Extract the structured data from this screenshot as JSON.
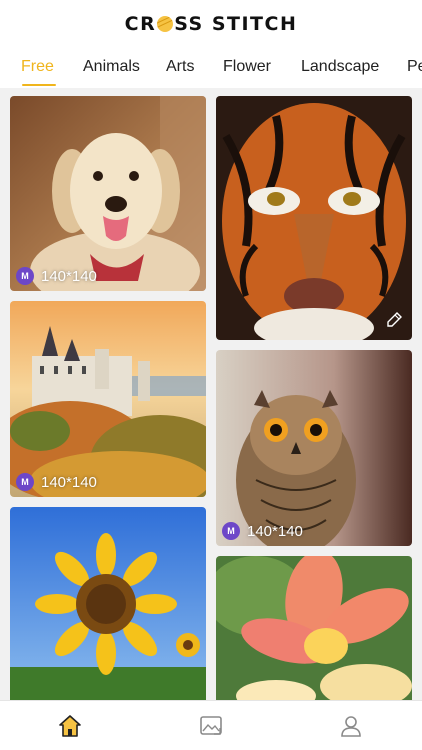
{
  "app": {
    "title_left": "CR",
    "title_right": "SS STITCH"
  },
  "tabs": [
    {
      "label": "Free",
      "active": true
    },
    {
      "label": "Animals",
      "active": false
    },
    {
      "label": "Arts",
      "active": false
    },
    {
      "label": "Flower",
      "active": false
    },
    {
      "label": "Landscape",
      "active": false
    },
    {
      "label": "Pe",
      "active": false
    }
  ],
  "colors": {
    "accent": "#f0b51c",
    "badge": "#6d47c8"
  },
  "cards": [
    {
      "subject": "golden retriever dog",
      "badge": "M",
      "size": "140*140"
    },
    {
      "subject": "tiger face",
      "badge": null,
      "size": null,
      "corner_icon": "pencil-icon"
    },
    {
      "subject": "castle in autumn",
      "badge": "M",
      "size": "140*140"
    },
    {
      "subject": "owl",
      "badge": "M",
      "size": "140*140"
    },
    {
      "subject": "sunflower",
      "badge": null,
      "size": null
    },
    {
      "subject": "plumeria flower",
      "badge": null,
      "size": null
    }
  ],
  "bottom_nav": [
    {
      "icon": "home-icon",
      "active": true
    },
    {
      "icon": "gallery-icon",
      "active": false
    },
    {
      "icon": "profile-icon",
      "active": false
    }
  ]
}
